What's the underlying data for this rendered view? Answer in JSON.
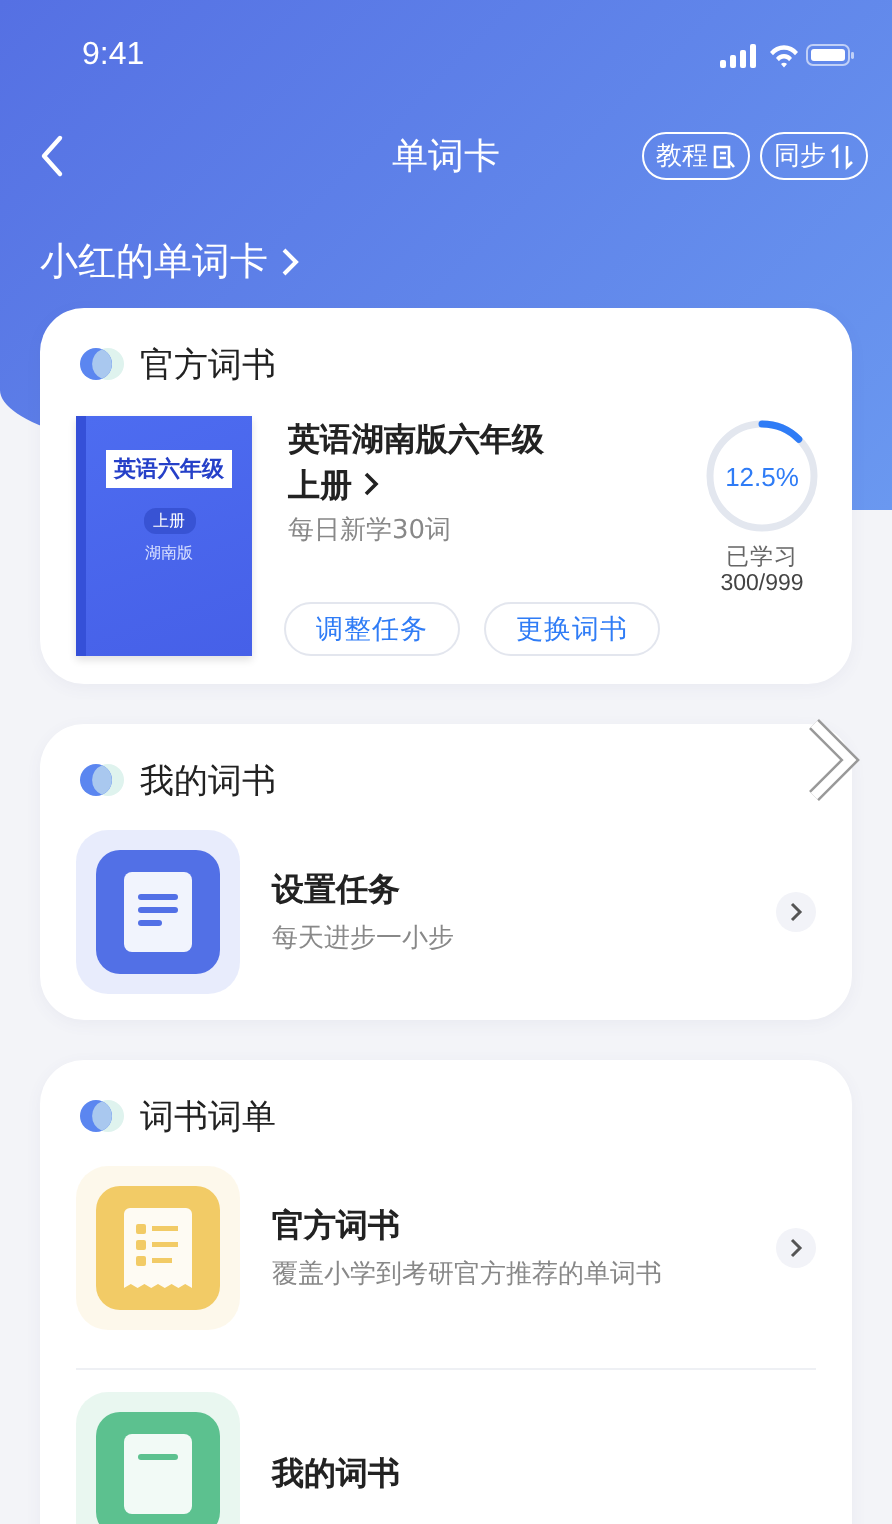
{
  "status_bar": {
    "time": "9:41"
  },
  "nav": {
    "title": "单词卡",
    "buttons": [
      {
        "label": "教程",
        "kind": "guide"
      },
      {
        "label": "同步",
        "kind": "sync"
      }
    ]
  },
  "heading": "小红的单词卡",
  "current_book": {
    "section_title": "官方词书",
    "cover_title": "英语六年级",
    "cover_badge": "上册",
    "cover_edition": "湖南版",
    "title": "英语湖南版六年级上册",
    "subtitle": "每日新学30词",
    "progress": {
      "percent": "12.5%",
      "label": "已学习",
      "count": "300/999"
    },
    "actions": [
      "调整任务",
      "更换词书"
    ]
  },
  "sections": [
    {
      "title": "我的词书",
      "items": [
        {
          "kind": "task",
          "color": "#5270e6",
          "title": "设置任务",
          "subtitle": "每天进步一小步"
        }
      ]
    },
    {
      "title": "词书词单",
      "items": [
        {
          "kind": "list",
          "color": "#f2cb66",
          "title": "官方词书",
          "subtitle": "覆盖小学到考研官方推荐的单词书"
        },
        {
          "kind": "book",
          "color": "#5cc18f",
          "title": "我的词书"
        }
      ]
    }
  ]
}
